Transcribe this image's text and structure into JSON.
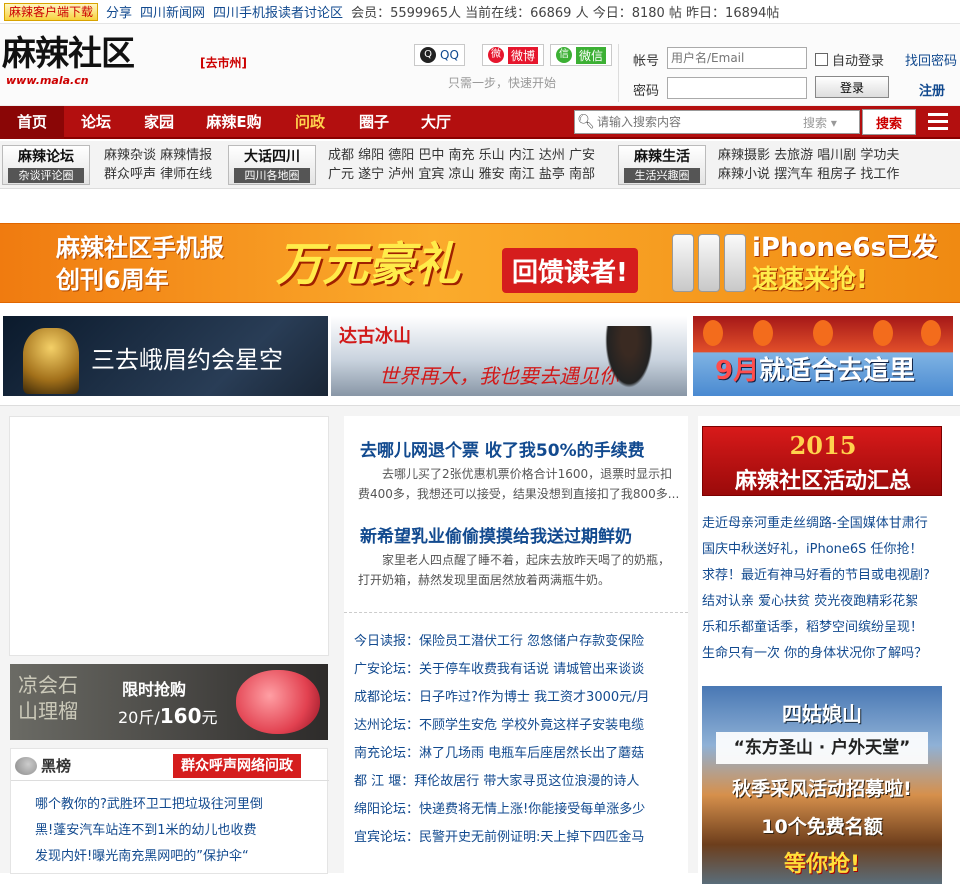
{
  "topbar": {
    "download_label": "麻辣客户端下载",
    "links": [
      "分享",
      "四川新闻网",
      "四川手机报读者讨论区"
    ],
    "stats": "会员：5599965人 当前在线：66869 人 今日：8180 帖 昨日：16894帖"
  },
  "header": {
    "logo_text": "麻辣社区",
    "logo_url": "www.mala.cn",
    "city": "[去市州]",
    "social": {
      "qq": "QQ",
      "weibo": "微博",
      "weixin": "微信",
      "tip": "只需一步，快速开始"
    },
    "login": {
      "account_label": "帐号",
      "account_placeholder": "用户名/Email",
      "password_label": "密码",
      "auto_login": "自动登录",
      "forgot": "找回密码",
      "login_button": "登录",
      "register": "注册"
    }
  },
  "nav": {
    "items": [
      "首页",
      "论坛",
      "家园",
      "麻辣E购",
      "问政",
      "圈子",
      "大厅"
    ],
    "search_placeholder": "请输入搜索内容",
    "search_type": "搜索",
    "search_button": "搜索"
  },
  "subnav": {
    "groups": [
      {
        "title": "麻辣论坛",
        "sub": "杂谈评论圈",
        "line1": "麻辣杂谈 麻辣情报",
        "line2": "群众呼声 律师在线"
      },
      {
        "title": "大话四川",
        "sub": "四川各地圈",
        "line1": "成都 绵阳 德阳 巴中 南充 乐山 内江 达州 广安",
        "line2": "广元 遂宁 泸州 宜宾 凉山 雅安 南江 盐亭 南部"
      },
      {
        "title": "麻辣生活",
        "sub": "生活兴趣圈",
        "line1": "麻辣摄影 去旅游 唱川剧 学功夫",
        "line2": "麻辣小说 摆汽车 租房子 找工作"
      }
    ]
  },
  "ads": {
    "main": {
      "line1": "麻辣社区手机报",
      "line2": "创刊6周年",
      "big": "万元豪礼",
      "tag": "回馈读者!",
      "right1": "iPhone6s已发",
      "right2": "速速来抢!"
    },
    "emei": "三去峨眉约会星空",
    "dagu": {
      "title": "达古冰山",
      "sub": "世界再大，我也要去遇见你"
    },
    "sept": {
      "month": "9月",
      "text": "就适合去這里"
    },
    "liu": {
      "name1": "凉会石",
      "name2": "山理榴",
      "line1": "限时抢购",
      "weight": "20斤/",
      "price": "160",
      "unit": "元"
    },
    "activity2015": {
      "year": "2015",
      "title": "麻辣社区活动汇总"
    },
    "sigu": {
      "title": "四姑娘山",
      "slogan": "“东方圣山 · 户外天堂”",
      "line1": "秋季采风活动招募啦!",
      "line2": "10个免费名额",
      "line3": "等你抢!"
    }
  },
  "blacklist": {
    "title": "黑榜",
    "tag": "群众呼声网络问政",
    "items": [
      "哪个教你的?武胜环卫工把垃圾往河里倒",
      "黑!蓬安汽车站连不到1米的幼儿也收费",
      "发现内奸!曝光南充黑网吧的”保护伞“"
    ]
  },
  "headlines": [
    {
      "title": "去哪儿网退个票 收了我50%的手续费",
      "summary": "去哪儿买了2张优惠机票价格合计1600，退票时显示扣费400多，我想还可以接受，结果没想到直接扣了我800多..."
    },
    {
      "title": "新希望乳业偷偷摸摸给我送过期鲜奶",
      "summary": "家里老人四点醒了睡不着，起床去放昨天喝了的奶瓶，打开奶箱，赫然发现里面居然放着两满瓶牛奶。"
    }
  ],
  "forum_lines": [
    {
      "src": "今日读报：",
      "text": "保险员工潜伏工行 忽悠储户存款变保险"
    },
    {
      "src": "广安论坛：",
      "text": "关于停车收费我有话说 请城管出来谈谈"
    },
    {
      "src": "成都论坛：",
      "text": "日子咋过?作为博士 我工资才3000元/月"
    },
    {
      "src": "达州论坛：",
      "text": "不顾学生安危 学校外竟这样子安装电缆"
    },
    {
      "src": "南充论坛：",
      "text": "淋了几场雨 电瓶车后座居然长出了蘑菇"
    },
    {
      "src": "都 江 堰：",
      "text": "拜伦故居行 带大家寻觅这位浪漫的诗人"
    },
    {
      "src": "绵阳论坛：",
      "text": "快递费将无情上涨!你能接受每单涨多少"
    },
    {
      "src": "宜宾论坛：",
      "text": "民警开史无前例证明:天上掉下四匹金马"
    }
  ],
  "right_links": [
    "走近母亲河重走丝绸路-全国媒体甘肃行",
    "国庆中秋送好礼，iPhone6S 任你抢！",
    "求荐！最近有神马好看的节目或电视剧?",
    "结对认亲 爱心扶贫 荧光夜跑精彩花絮",
    "乐和乐都童话季，稻梦空间缤纷呈现！",
    "生命只有一次 你的身体状况你了解吗？"
  ],
  "colors": {
    "nav_red": "#b30f0f",
    "link_blue": "#124a8f",
    "accent_red": "#d51d1d"
  }
}
